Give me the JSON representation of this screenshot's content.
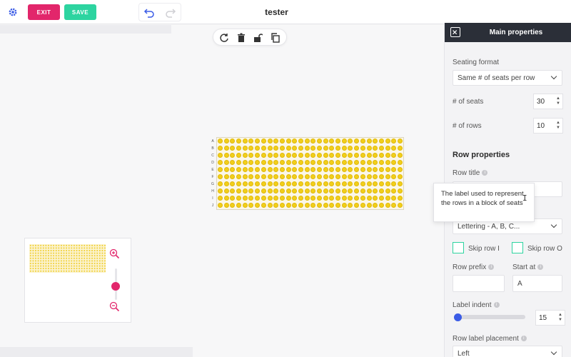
{
  "app": {
    "title": "tester",
    "buttons": {
      "exit": "EXIT",
      "save": "SAVE"
    },
    "icons": [
      "gear-icon",
      "undo-icon",
      "redo-icon",
      "refresh-icon",
      "trash-icon",
      "unlock-icon",
      "copy-icon",
      "zoom-in-icon",
      "zoom-out-icon",
      "close-icon",
      "info-icon",
      "text-cursor-icon"
    ],
    "colors": {
      "accent_pink": "#e2266b",
      "accent_green": "#2dd4a0",
      "seat_yellow": "#f2cf1a",
      "slider_blue": "#3b5ce6",
      "panel_header": "#2b2f38"
    }
  },
  "seat_block": {
    "row_letters": [
      "A",
      "B",
      "C",
      "D",
      "E",
      "F",
      "G",
      "H",
      "I",
      "J"
    ],
    "seats_per_row": 30
  },
  "minimap": {
    "zoom_level": 0.5
  },
  "panel": {
    "title": "Main properties",
    "seating_format": {
      "label": "Seating format",
      "value": "Same # of seats per row"
    },
    "seats": {
      "label": "# of seats",
      "value": "30"
    },
    "rows": {
      "label": "# of rows",
      "value": "10"
    },
    "row_properties": "Row properties",
    "row_title": {
      "label": "Row title",
      "value": ""
    },
    "tooltip": "The label used to represent the rows in a block of seats",
    "lettering": {
      "value": "Lettering - A, B, C..."
    },
    "skip_row_i": "Skip row I",
    "skip_row_o": "Skip row O",
    "row_prefix": {
      "label": "Row prefix",
      "value": ""
    },
    "start_at": {
      "label": "Start at",
      "value": "A"
    },
    "label_indent": {
      "label": "Label indent",
      "value": "15"
    },
    "row_label_placement": {
      "label": "Row label placement",
      "value": "Left"
    }
  }
}
